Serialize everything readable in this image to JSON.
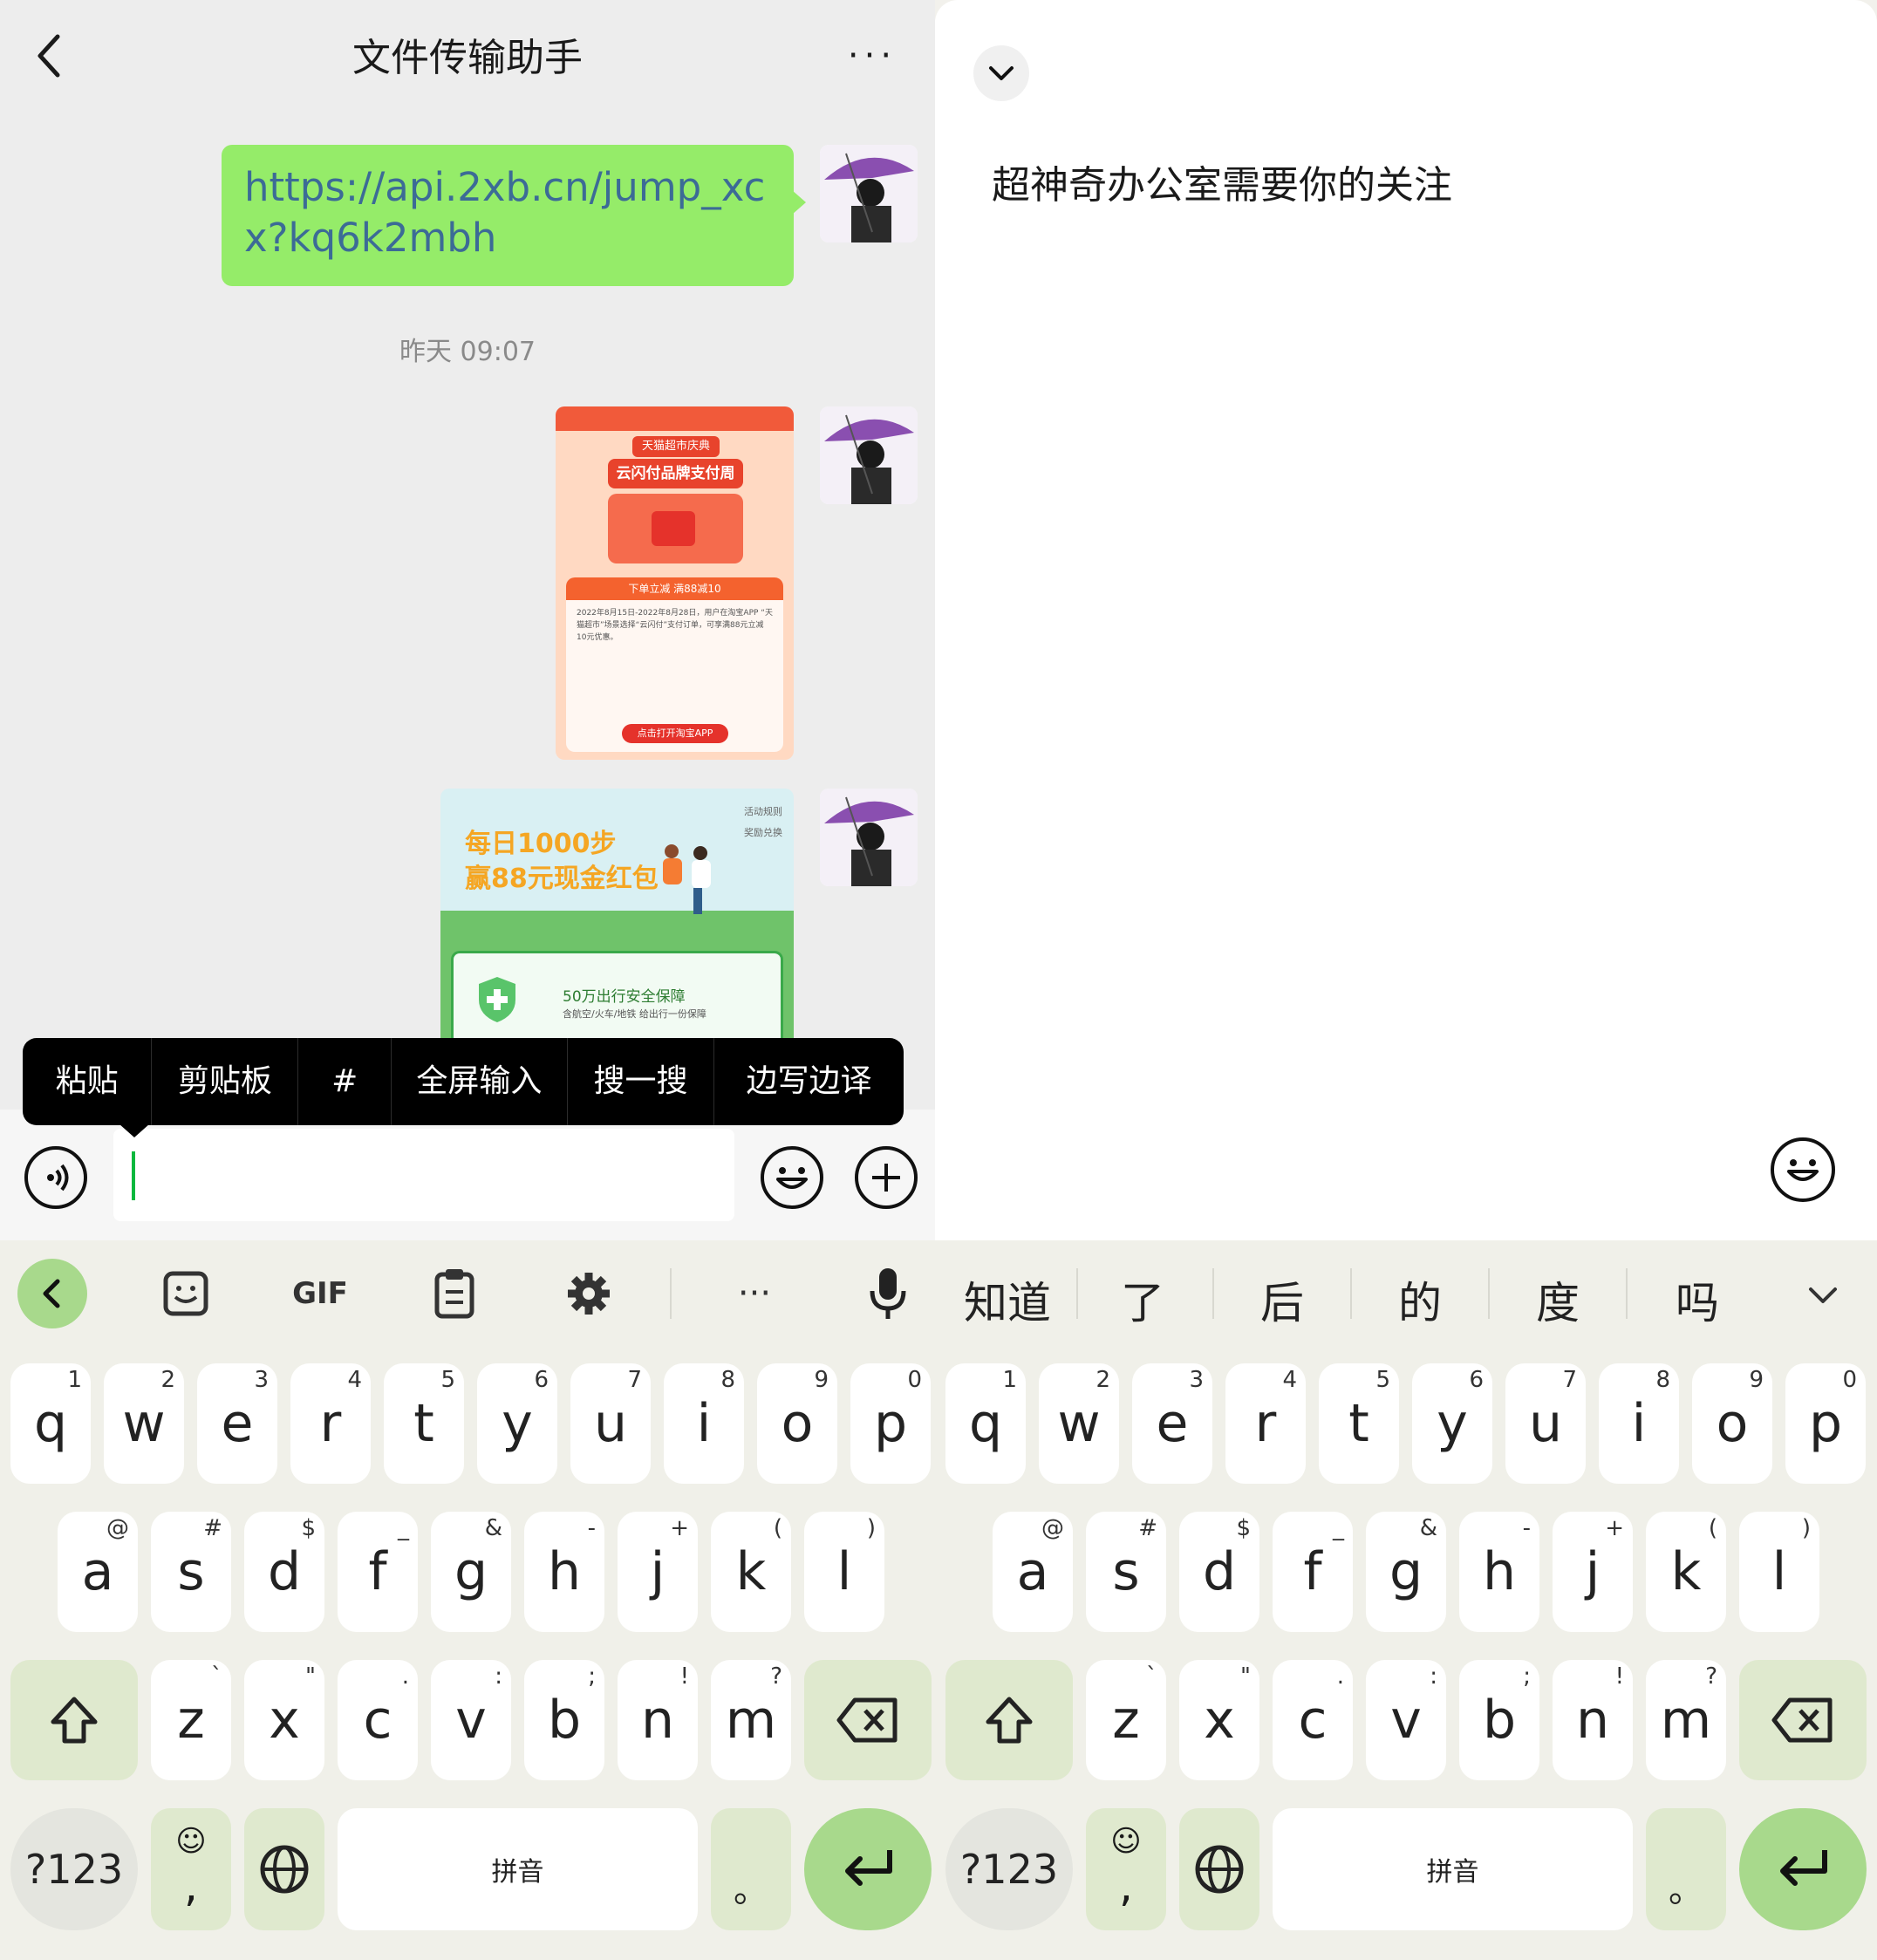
{
  "chat": {
    "title": "文件传输助手",
    "more_label": "···",
    "link_message": "https://api.2xb.cn/jump_xcx?kq6k2mbh",
    "timestamp": "昨天 09:07",
    "image1": {
      "badge": "天猫超市庆典",
      "headline": "云闪付品牌支付周",
      "offer": "下单立减 满88减10",
      "desc": "2022年8月15日-2022年8月28日，用户在淘宝APP “天猫超市”场景选择“云闪付”支付订单，可享满88元立减10元优惠。",
      "button": "点击打开淘宝APP"
    },
    "image2": {
      "headline1": "每日1000步",
      "headline2": "赢88元现金红包",
      "side1": "活动规则",
      "side2": "奖励兑换",
      "card_title": "50万出行安全保障",
      "card_sub": "含航空/火车/地铁 给出行一份保障"
    }
  },
  "context_menu": [
    "粘贴",
    "剪贴板",
    "#",
    "全屏输入",
    "搜一搜",
    "边写边译"
  ],
  "fullscreen_input": {
    "text": "超神奇办公室需要你的关注"
  },
  "keyboard": {
    "toolbar": {
      "gif": "GIF",
      "more": "···"
    },
    "candidates": [
      "知道",
      "了",
      "后",
      "的",
      "度",
      "吗"
    ],
    "row1": [
      {
        "k": "q",
        "h": "1"
      },
      {
        "k": "w",
        "h": "2"
      },
      {
        "k": "e",
        "h": "3"
      },
      {
        "k": "r",
        "h": "4"
      },
      {
        "k": "t",
        "h": "5"
      },
      {
        "k": "y",
        "h": "6"
      },
      {
        "k": "u",
        "h": "7"
      },
      {
        "k": "i",
        "h": "8"
      },
      {
        "k": "o",
        "h": "9"
      },
      {
        "k": "p",
        "h": "0"
      }
    ],
    "row2": [
      {
        "k": "a",
        "h": "@"
      },
      {
        "k": "s",
        "h": "#"
      },
      {
        "k": "d",
        "h": "$"
      },
      {
        "k": "f",
        "h": "_"
      },
      {
        "k": "g",
        "h": "&"
      },
      {
        "k": "h",
        "h": "-"
      },
      {
        "k": "j",
        "h": "+"
      },
      {
        "k": "k",
        "h": "("
      },
      {
        "k": "l",
        "h": ")"
      }
    ],
    "row3": [
      {
        "k": "z",
        "h": "`"
      },
      {
        "k": "x",
        "h": "\""
      },
      {
        "k": "c",
        "h": "."
      },
      {
        "k": "v",
        "h": ":"
      },
      {
        "k": "b",
        "h": ";"
      },
      {
        "k": "n",
        "h": "!"
      },
      {
        "k": "m",
        "h": "?"
      }
    ],
    "symbols_label": "?123",
    "comma_label": ",",
    "emoji_hint": "☺",
    "space_label": "拼音",
    "period_label": "。"
  }
}
